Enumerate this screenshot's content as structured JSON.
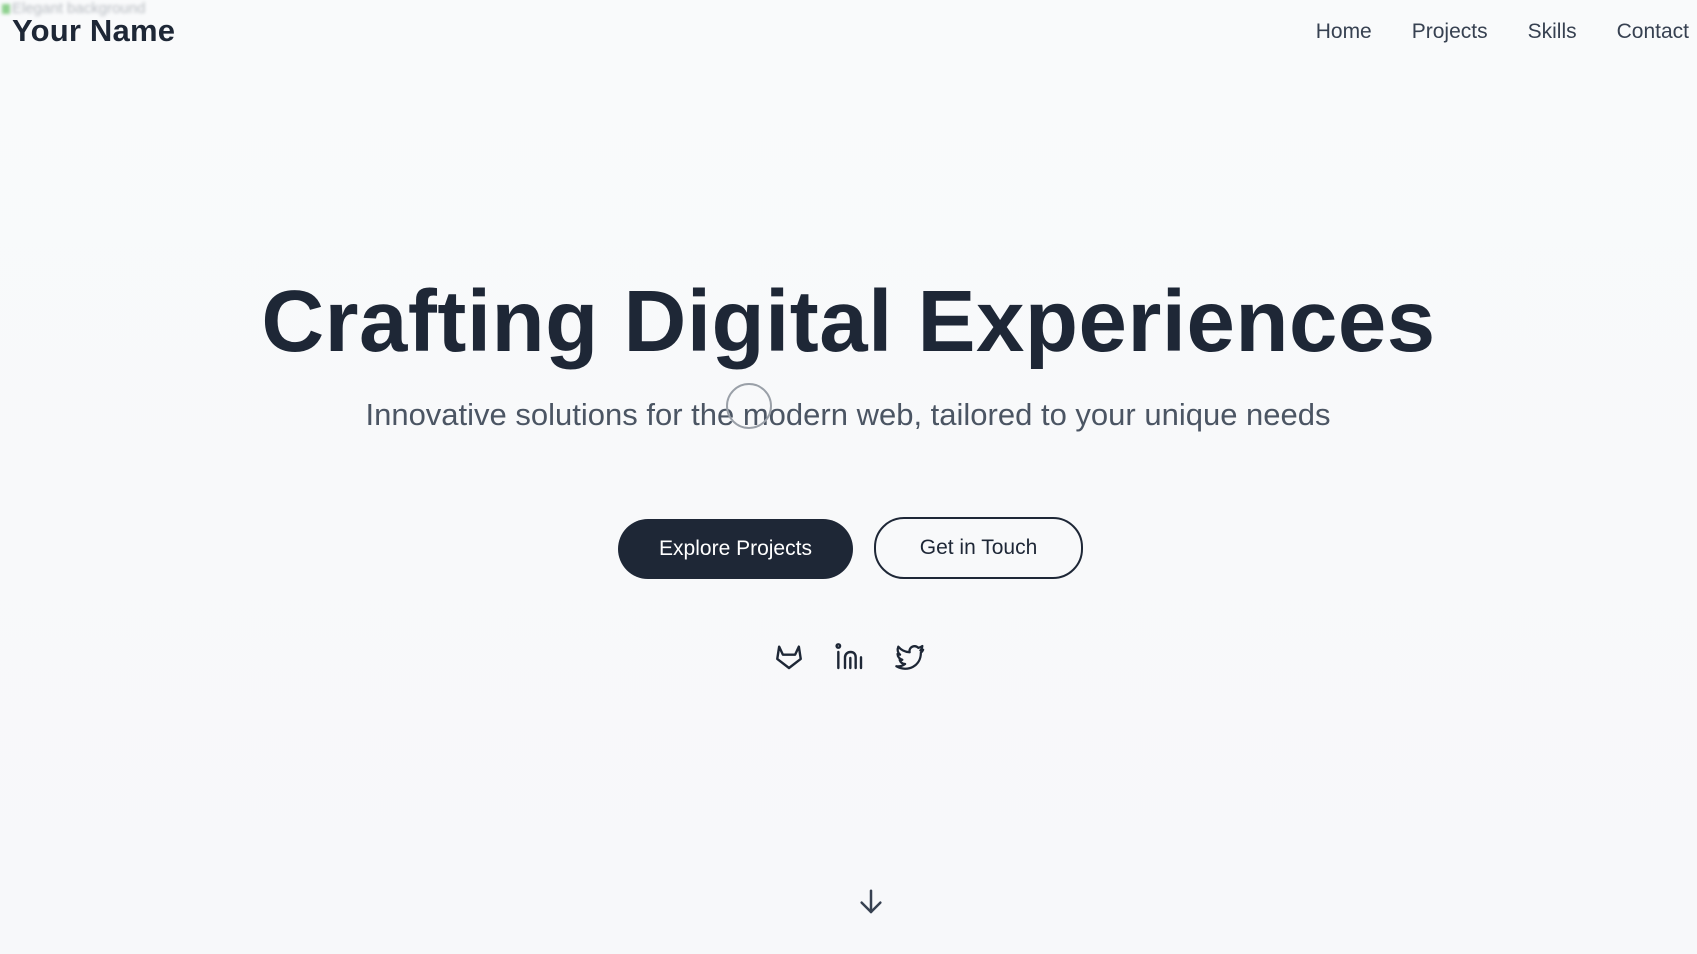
{
  "background_image": {
    "alt_text": "Elegant background"
  },
  "header": {
    "logo": "Your Name",
    "nav": [
      {
        "label": "Home"
      },
      {
        "label": "Projects"
      },
      {
        "label": "Skills"
      },
      {
        "label": "Contact"
      }
    ]
  },
  "hero": {
    "title": "Crafting Digital Experiences",
    "subtitle": "Innovative solutions for the modern web, tailored to your unique needs",
    "primary_button": "Explore Projects",
    "secondary_button": "Get in Touch"
  },
  "social": {
    "icons": [
      "gitlab-icon",
      "linkedin-icon",
      "twitter-icon"
    ]
  },
  "scroll_indicator": {
    "icon": "arrow-down-icon"
  },
  "colors": {
    "background": "#f8f9fa",
    "primary": "#1e2736",
    "text_muted": "#4b5563"
  }
}
